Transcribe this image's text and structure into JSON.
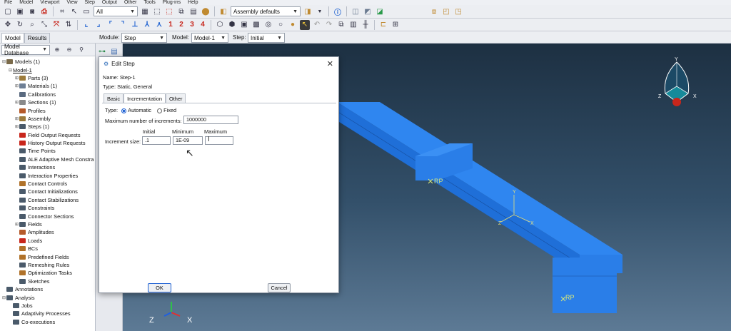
{
  "menu": [
    "File",
    "Model",
    "Viewport",
    "View",
    "Step",
    "Output",
    "Other",
    "Tools",
    "Plug-ins",
    "Help"
  ],
  "toolbar": {
    "filter_value": "All",
    "render_defaults": "Assembly defaults",
    "numbers": [
      "1",
      "2",
      "3",
      "4"
    ]
  },
  "module_bar": {
    "tabs": [
      "Model",
      "Results"
    ],
    "module_label": "Module:",
    "module_value": "Step",
    "model_label": "Model:",
    "model_value": "Model-1",
    "step_label": "Step:",
    "step_value": "Initial"
  },
  "left_panel": {
    "dropdown": "Model Database",
    "tree": [
      {
        "exp": "⊟",
        "indent": 0,
        "label": "Models (1)",
        "color": "#7a6a4a"
      },
      {
        "exp": "⊟",
        "indent": 1,
        "label": "Model-1",
        "color": "",
        "underline": true
      },
      {
        "exp": "⊞",
        "indent": 2,
        "label": "Parts (3)",
        "color": "#9c7b3b"
      },
      {
        "exp": "⊞",
        "indent": 2,
        "label": "Materials (1)",
        "color": "#6e7f95"
      },
      {
        "exp": "",
        "indent": 2,
        "label": "Calibrations",
        "color": "#5a6a80"
      },
      {
        "exp": "⊞",
        "indent": 2,
        "label": "Sections (1)",
        "color": "#8a8a8a"
      },
      {
        "exp": "",
        "indent": 2,
        "label": "Profiles",
        "color": "#b55a2a"
      },
      {
        "exp": "⊞",
        "indent": 2,
        "label": "Assembly",
        "color": "#9c7b3b"
      },
      {
        "exp": "⊞",
        "indent": 2,
        "label": "Steps (1)",
        "color": "#4a5a6a"
      },
      {
        "exp": "",
        "indent": 2,
        "label": "Field Output Requests",
        "color": "#c8261c"
      },
      {
        "exp": "",
        "indent": 2,
        "label": "History Output Requests",
        "color": "#c8261c"
      },
      {
        "exp": "",
        "indent": 2,
        "label": "Time Points",
        "color": "#4a5a6a"
      },
      {
        "exp": "",
        "indent": 2,
        "label": "ALE Adaptive Mesh Constra",
        "color": "#4a5a6a"
      },
      {
        "exp": "",
        "indent": 2,
        "label": "Interactions",
        "color": "#4a5a6a"
      },
      {
        "exp": "",
        "indent": 2,
        "label": "Interaction Properties",
        "color": "#4a5a6a"
      },
      {
        "exp": "",
        "indent": 2,
        "label": "Contact Controls",
        "color": "#b0722a"
      },
      {
        "exp": "",
        "indent": 2,
        "label": "Contact Initializations",
        "color": "#4a5a6a"
      },
      {
        "exp": "",
        "indent": 2,
        "label": "Contact Stabilizations",
        "color": "#4a5a6a"
      },
      {
        "exp": "",
        "indent": 2,
        "label": "Constraints",
        "color": "#4a5a6a"
      },
      {
        "exp": "",
        "indent": 2,
        "label": "Connector Sections",
        "color": "#4a5a6a"
      },
      {
        "exp": "⊞",
        "indent": 2,
        "label": "Fields",
        "color": "#4a5a6a"
      },
      {
        "exp": "",
        "indent": 2,
        "label": "Amplitudes",
        "color": "#b55a2a"
      },
      {
        "exp": "",
        "indent": 2,
        "label": "Loads",
        "color": "#c8261c"
      },
      {
        "exp": "",
        "indent": 2,
        "label": "BCs",
        "color": "#b0722a"
      },
      {
        "exp": "",
        "indent": 2,
        "label": "Predefined Fields",
        "color": "#b0722a"
      },
      {
        "exp": "",
        "indent": 2,
        "label": "Remeshing Rules",
        "color": "#4a5a6a"
      },
      {
        "exp": "",
        "indent": 2,
        "label": "Optimization Tasks",
        "color": "#b0722a"
      },
      {
        "exp": "",
        "indent": 2,
        "label": "Sketches",
        "color": "#4a5a6a"
      },
      {
        "exp": "",
        "indent": 0,
        "label": "Annotations",
        "color": "#4a5a6a"
      },
      {
        "exp": "⊟",
        "indent": 0,
        "label": "Analysis",
        "color": "#4a5a6a"
      },
      {
        "exp": "",
        "indent": 1,
        "label": "Jobs",
        "color": "#4a5a6a"
      },
      {
        "exp": "",
        "indent": 1,
        "label": "Adaptivity Processes",
        "color": "#4a5a6a"
      },
      {
        "exp": "",
        "indent": 1,
        "label": "Co-executions",
        "color": "#4a5a6a"
      }
    ]
  },
  "viewport": {
    "rp_label": "RP",
    "triad": {
      "x": "X",
      "y": "Y",
      "z": "Z"
    },
    "beam_color": "#2a7ee8"
  },
  "dialog": {
    "title": "Edit Step",
    "name_label": "Name:",
    "name_value": "Step-1",
    "type_label": "Type:",
    "type_value": "Static, General",
    "tabs": [
      "Basic",
      "Incrementation",
      "Other"
    ],
    "inc_type_label": "Type:",
    "automatic": "Automatic",
    "fixed": "Fixed",
    "max_inc_label": "Maximum number of increments:",
    "max_inc_value": "1000000",
    "col_initial": "Initial",
    "col_minimum": "Minimum",
    "col_maximum": "Maximum",
    "inc_size_label": "Increment size:",
    "initial_value": ".1",
    "minimum_value": "1E-09",
    "maximum_value": "",
    "ok": "OK",
    "cancel": "Cancel"
  }
}
